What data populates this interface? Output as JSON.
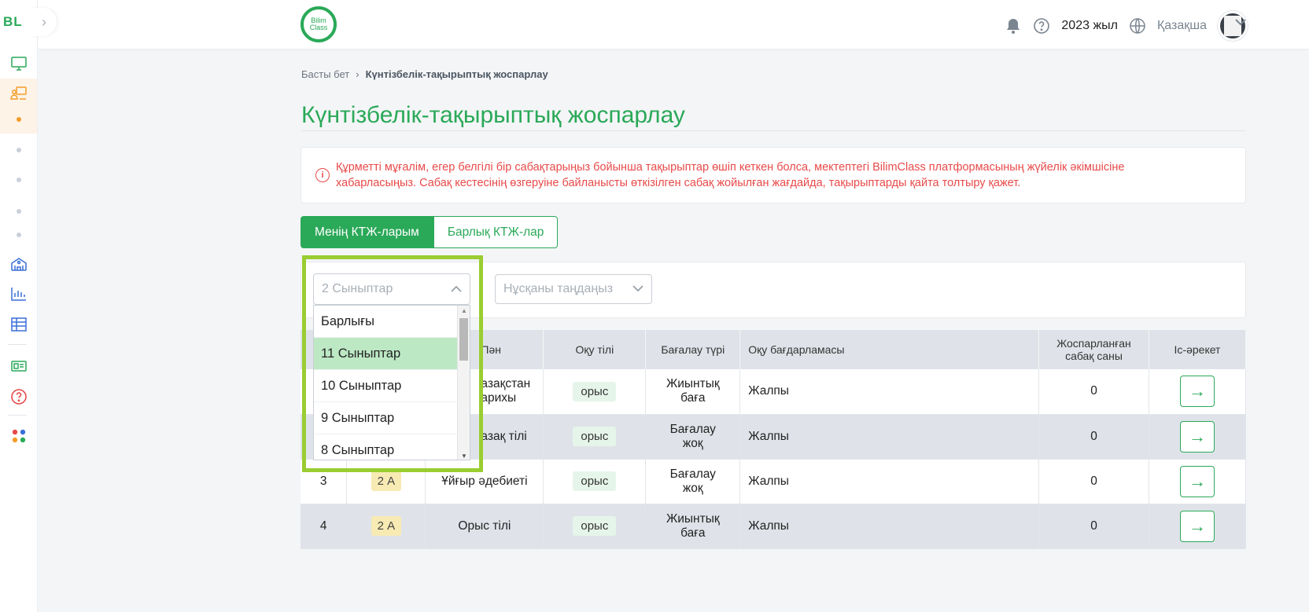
{
  "rail": {
    "logo": "BL",
    "toggle_icon": "chevron-right-icon",
    "items": [
      {
        "icon": "monitor-icon"
      },
      {
        "icon": "teacher-board-icon",
        "active": true
      },
      {
        "icon": "school-icon"
      },
      {
        "icon": "bar-chart-icon"
      },
      {
        "icon": "table-icon"
      },
      {
        "icon": "id-card-icon"
      },
      {
        "icon": "help-circle-icon"
      },
      {
        "icon": "apps-grid-icon"
      }
    ]
  },
  "header": {
    "brand_line1": "Bilim",
    "brand_line2": "Class",
    "year": "2023 жыл",
    "language": "Қазақша"
  },
  "breadcrumb": {
    "home": "Басты бет",
    "current": "Күнтізбелік-тақырыптық жоспарлау"
  },
  "page_title": "Күнтізбелік-тақырыптық жоспарлау",
  "notice": {
    "line1": "Құрметті мұғалім, егер белгілі бір сабақтарыңыз бойынша тақырыптар өшіп кеткен болса, мектептегі BilimClass платформасының жүйелік әкімшісіне",
    "line2": "хабарласыңыз. Сабақ кестесінің өзгеруіне байланысты өткізілген сабақ жойылған жағдайда, тақырыптарды қайта толтыру қажет."
  },
  "tabs": {
    "mine": "Менің КТЖ-ларым",
    "all": "Барлық КТЖ-лар"
  },
  "filters": {
    "class_select_value": "2 Сыныптар",
    "variant_select_placeholder": "Нұсқаны таңдаңыз"
  },
  "dropdown": {
    "options": [
      "Барлығы",
      "11 Сыныптар",
      "10 Сыныптар",
      "9 Сыныптар",
      "8 Сыныптар"
    ],
    "highlighted": "11 Сыныптар"
  },
  "table": {
    "headers": {
      "subject": "Пән",
      "language": "Оқу тілі",
      "assessment": "Бағалау түрі",
      "program": "Оқу бағдарламасы",
      "planned_line1": "Жоспарланған",
      "planned_line2": "сабақ саны",
      "action": "Іс-әрекет"
    },
    "rows": [
      {
        "subject_line1": "азақстан",
        "subject_line2": "арихы",
        "lang": "орыс",
        "assess_line1": "Жиынтық",
        "assess_line2": "баға",
        "program": "Жалпы",
        "planned": "0"
      },
      {
        "subject_line1": "азақ тілі",
        "subject_line2": "",
        "lang": "орыс",
        "assess_line1": "Бағалау",
        "assess_line2": "жоқ",
        "program": "Жалпы",
        "planned": "0"
      },
      {
        "num": "3",
        "class": "2 А",
        "subject_line1": "Ұйғыр әдебиеті",
        "subject_line2": "",
        "lang": "орыс",
        "assess_line1": "Бағалау",
        "assess_line2": "жоқ",
        "program": "Жалпы",
        "planned": "0"
      },
      {
        "num": "4",
        "class": "2 А",
        "subject_line1": "Орыс тілі",
        "subject_line2": "",
        "lang": "орыс",
        "assess_line1": "Жиынтық",
        "assess_line2": "баға",
        "program": "Жалпы",
        "planned": "0"
      }
    ]
  },
  "colors": {
    "brand_green": "#2aa958",
    "notice_red": "#e84a4a",
    "highlight_outline": "#9acd32"
  }
}
